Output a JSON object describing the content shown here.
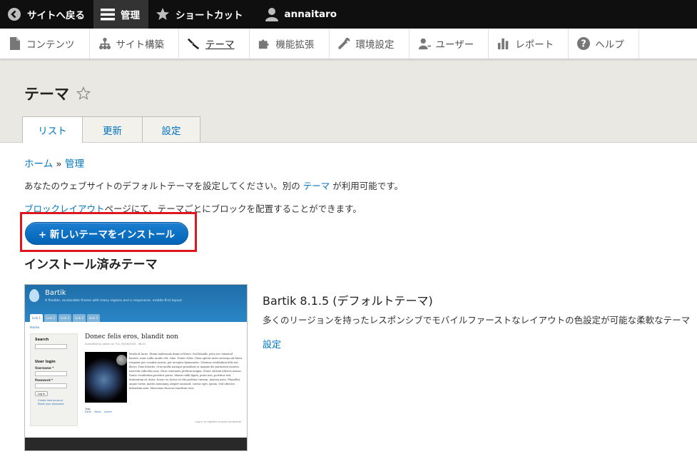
{
  "toolbar": {
    "back": "サイトへ戻る",
    "manage": "管理",
    "shortcuts": "ショートカット",
    "user": "annaitaro"
  },
  "tray": [
    {
      "label": "コンテンツ",
      "icon": "file-icon"
    },
    {
      "label": "サイト構築",
      "icon": "sitemap-icon"
    },
    {
      "label": "テーマ",
      "icon": "paintbrush-icon"
    },
    {
      "label": "機能拡張",
      "icon": "puzzle-icon"
    },
    {
      "label": "環境設定",
      "icon": "wrench-icon"
    },
    {
      "label": "ユーザー",
      "icon": "people-icon"
    },
    {
      "label": "レポート",
      "icon": "barchart-icon"
    },
    {
      "label": "ヘルプ",
      "icon": "help-icon"
    }
  ],
  "header": {
    "title": "テーマ",
    "tabs": [
      "リスト",
      "更新",
      "設定"
    ]
  },
  "breadcrumb": {
    "home": "ホーム",
    "sep": " » ",
    "admin": "管理"
  },
  "intro": {
    "before": "あなたのウェブサイトのデフォルトテーマを設定してください。別の ",
    "link": "テーマ",
    "after": " が利用可能です。"
  },
  "block": {
    "link": "ブロックレイアウト",
    "after": "ページにて、テーマごとにブロックを配置することができます。"
  },
  "install_button": "+ 新しいテーマをインストール",
  "installed_title": "インストール済みテーマ",
  "theme": {
    "name": "Bartik 8.1.5 (デフォルトテーマ)",
    "description": "多くのリージョンを持ったレスポンシブでモバイルファーストなレイアウトの色設定が可能な柔軟なテーマ",
    "settings": "設定"
  },
  "screenshot": {
    "site_name": "Bartik",
    "slogan": "A flexible, recolorable theme with many regions and a responsive, mobile-first layout.",
    "tabs": [
      "Link 1",
      "Link 2",
      "Link 3",
      "Link 4",
      "Link 5"
    ],
    "home": "Home",
    "search_title": "Search",
    "login_title": "User login",
    "username": "Username *",
    "password": "Password *",
    "login_btn": "Log in",
    "create": "Create new account",
    "reset": "Reset your password",
    "article_title": "Donec felis eros, blandit non",
    "submitted": "Submitted by admin on Thu, 06/16/2016 - 08:20",
    "body": "Morbi id lacus. Etiam malesuada diam ut libero. Sed blandit, justo nec euismod laoreet, nunc nulla iaculis elit, vitae. Donec dolor. Class aptent taciti sociosqu ad litora torquent per conubia nostra, per inceptos hymenaeos. Vivamus vestibulum felis nec libero. Duis lobortis. Cras mollis natoque penatibus et magnis dis parturient montes, nascetur ridiculus mus. Nunc venenatis pretium magna. Donec dictum ultrices massa. Donec vestibulum porttitor purus. Mauris nibh ligula, porta non, porttitor sed, fermentum id, dolor. Donec eu lectus et elit porttitor rutrum. Aenean justo. Phasellus augue tortor, mattis nonummy, aliquet euismod, cursus eget, ipsum. Sed ultricies bibendum ante. Maecenas rhoncus tincidunt eros.",
    "tags_label": "Tags",
    "tags": [
      "Earth",
      "Moon",
      "Lorem"
    ],
    "login_note": "Log in or register to post comments"
  }
}
